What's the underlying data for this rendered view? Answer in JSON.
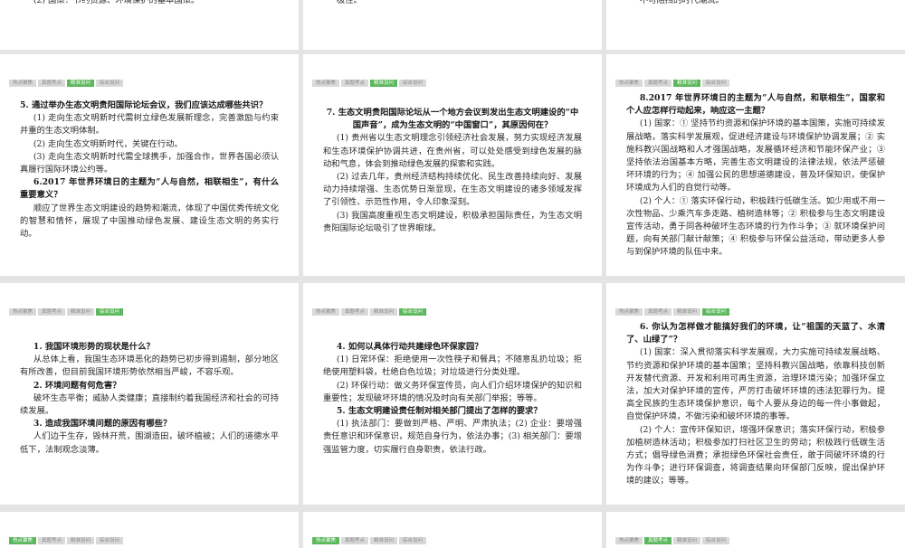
{
  "cards": [
    {
      "id": "c1",
      "tabs": [],
      "active": -1,
      "lines": [
        {
          "t": "p",
          "text": "(2) 国策：节约资源、环境保护的基本国策。"
        }
      ]
    },
    {
      "id": "c2",
      "tabs": [],
      "active": -1,
      "lines": [
        {
          "t": "p",
          "text": "极性。"
        }
      ]
    },
    {
      "id": "c3",
      "tabs": [],
      "active": -1,
      "lines": [
        {
          "t": "p",
          "text": "不可阻挡的时代潮流。"
        }
      ]
    },
    {
      "id": "c4",
      "tabs": [
        "热点聚焦",
        "真题考点",
        "精准设问",
        "综合设问"
      ],
      "active": 2,
      "lines": [
        {
          "t": "q",
          "text": "5. 通过举办生态文明贵阳国际论坛会议，我们应该达成哪些共识？"
        },
        {
          "t": "p",
          "text": "(1) 走向生态文明新时代需树立绿色发展新理念，完善激励与约束并重的生态文明体制。"
        },
        {
          "t": "p",
          "text": "(2) 走向生态文明新时代，关键在行动。"
        },
        {
          "t": "p",
          "text": "(3) 走向生态文明新时代需全球携手，加强合作，世界各国必须认真履行国际环境公约等。"
        },
        {
          "t": "qi",
          "text": "6.2017 年世界环境日的主题为“人与自然，相联相生”，有什么重要意义？"
        },
        {
          "t": "p",
          "text": "顺应了世界生态文明建设的趋势和潮流，体现了中国优秀传统文化的智慧和情怀，展现了中国推动绿色发展、建设生态文明的务实行动。"
        }
      ]
    },
    {
      "id": "c5",
      "tabs": [
        "热点聚焦",
        "真题考点",
        "精准设问",
        "综合设问"
      ],
      "active": 2,
      "lines": [
        {
          "t": "qc",
          "text": "7. 生态文明贵阳国际论坛从一个地方会议到发出生态文明建设的“中国声音”，成为生态文明的“中国窗口”，其原因何在？"
        },
        {
          "t": "p",
          "text": "(1) 贵州省以生态文明理念引领经济社会发展，努力实现经济发展和生态环境保护协调共进，在贵州省，可以处处感受到绿色发展的脉动和气息，体会到推动绿色发展的探索和实践。"
        },
        {
          "t": "p",
          "text": "(2) 过去几年，贵州经济结构持续优化、民生改善持续向好、发展动力持续增强、生态优势日渐显现，在生态文明建设的诸多领域发挥了引领性、示范性作用，令人印象深刻。"
        },
        {
          "t": "p",
          "text": "(3) 我国高度重视生态文明建设，积极承担国际责任，为生态文明贵阳国际论坛吸引了世界眼球。"
        }
      ]
    },
    {
      "id": "c6",
      "tabs": [
        "热点聚焦",
        "真题考点",
        "精准设问",
        "综合设问"
      ],
      "active": 2,
      "lines": [
        {
          "t": "qi",
          "text": "8.2017 年世界环境日的主题为“人与自然，和联相生”，国家和个人应怎样行动起来，响应这一主题？"
        },
        {
          "t": "p",
          "text": "(1) 国家：① 坚持节约资源和保护环境的基本国策，实施可持续发展战略，落实科学发展观，促进经济建设与环境保护协调发展；② 实施科教兴国战略和人才强国战略，发展循环经济和节能环保产业；③ 坚持依法治国基本方略，完善生态文明建设的法律法规，依法严惩破坏环境的行为；④ 加强公民的思想道德建设，普及环保知识，使保护环境成为人们的自觉行动等。"
        },
        {
          "t": "p",
          "text": "(2) 个人：① 落实环保行动，积极践行低碳生活。如少用或不用一次性物品、少乘汽车多走路、植树造林等；② 积极参与生态文明建设宣传活动，勇于同各种破坏生态环境的行为作斗争；③ 就环境保护问题，向有关部门献计献策；④ 积极参与环保公益活动，带动更多人参与到保护环境的队伍中来。"
        }
      ]
    },
    {
      "id": "c7",
      "tabs": [
        "热点聚焦",
        "真题考点",
        "精准设问",
        "综合设问"
      ],
      "active": 3,
      "lines": [
        {
          "t": "qi",
          "text": "1. 我国环境形势的现状是什么？"
        },
        {
          "t": "p",
          "text": "从总体上看，我国生态环境恶化的趋势已初步得到遏制，部分地区有所改善，但目前我国环境形势依然相当严峻，不容乐观。"
        },
        {
          "t": "qi",
          "text": "2. 环境问题有何危害？"
        },
        {
          "t": "p",
          "text": "破坏生态平衡；威胁人类健康；直接制约着我国经济和社会的可持续发展。"
        },
        {
          "t": "qi",
          "text": "3. 造成我国环境问题的原因有哪些？"
        },
        {
          "t": "p",
          "text": "人们边干生存，毁林开荒，围湖造田，破坏植被；人们的道德水平低下，法制观念淡薄。"
        }
      ]
    },
    {
      "id": "c8",
      "tabs": [
        "热点聚焦",
        "真题考点",
        "精准设问",
        "综合设问"
      ],
      "active": 3,
      "lines": [
        {
          "t": "qi",
          "text": "4. 如何以具体行动共建绿色环保家园？"
        },
        {
          "t": "p",
          "text": "(1) 日常环保：拒绝使用一次性筷子和餐具；不随意乱扔垃圾；拒绝使用塑料袋，杜绝白色垃圾；对垃圾进行分类处理。"
        },
        {
          "t": "p",
          "text": "(2) 环保行动：做义务环保宣传员，向人们介绍环境保护的知识和重要性；发现破坏环境的情况及时向有关部门举报；等等。"
        },
        {
          "t": "qi",
          "text": "5. 生态文明建设责任制对相关部门提出了怎样的要求？"
        },
        {
          "t": "p",
          "text": "(1) 执法部门：要做到严格、严明、严肃执法；(2) 企业：要增强责任意识和环保意识，规范自身行为，依法办事；(3) 相关部门：要增强监管力度，切实履行自身职责，依法行政。"
        }
      ]
    },
    {
      "id": "c9",
      "tabs": [
        "热点聚焦",
        "真题考点",
        "精准设问",
        "综合设问"
      ],
      "active": 3,
      "lines": [
        {
          "t": "qi",
          "text": "6. 你认为怎样做才能搞好我们的环境，让“祖国的天蓝了、水清了、山绿了”？"
        },
        {
          "t": "p",
          "text": "(1) 国家：深入贯彻落实科学发展观，大力实施可持续发展战略、节约资源和保护环境的基本国策；坚持科教兴国战略，依靠科技创新开发替代资源、开发和利用可再生资源，治理环境污染；加强环保立法，加大对保护环境的宣传，严厉打击破坏环境的违法犯罪行为。提高全民族的生态环境保护意识，每个人要从身边的每一件小事做起，自觉保护环境，不做污染和破坏环境的事等。"
        },
        {
          "t": "p",
          "text": "(2) 个人：宣传环保知识，增强环保意识；落实环保行动，积极参加植树造林活动；积极参加打扫社区卫生的劳动；积极践行低碳生活方式；倡导绿色消费；承担绿色环保社会责任，敢于同破坏环境的行为作斗争；进行环保调查，将调查结果向环保部门反映，提出保护环境的建议；等等。"
        }
      ]
    },
    {
      "id": "c10",
      "tabs": [
        "热点聚焦",
        "真题考点",
        "精准设问",
        "综合设问"
      ],
      "active": 0,
      "lines": []
    },
    {
      "id": "c11",
      "tabs": [
        "热点聚焦",
        "真题考点",
        "精准设问",
        "综合设问"
      ],
      "active": 0,
      "lines": []
    },
    {
      "id": "c12",
      "tabs": [
        "热点聚焦",
        "真题考点",
        "精准设问",
        "综合设问"
      ],
      "active": 1,
      "lines": []
    }
  ]
}
